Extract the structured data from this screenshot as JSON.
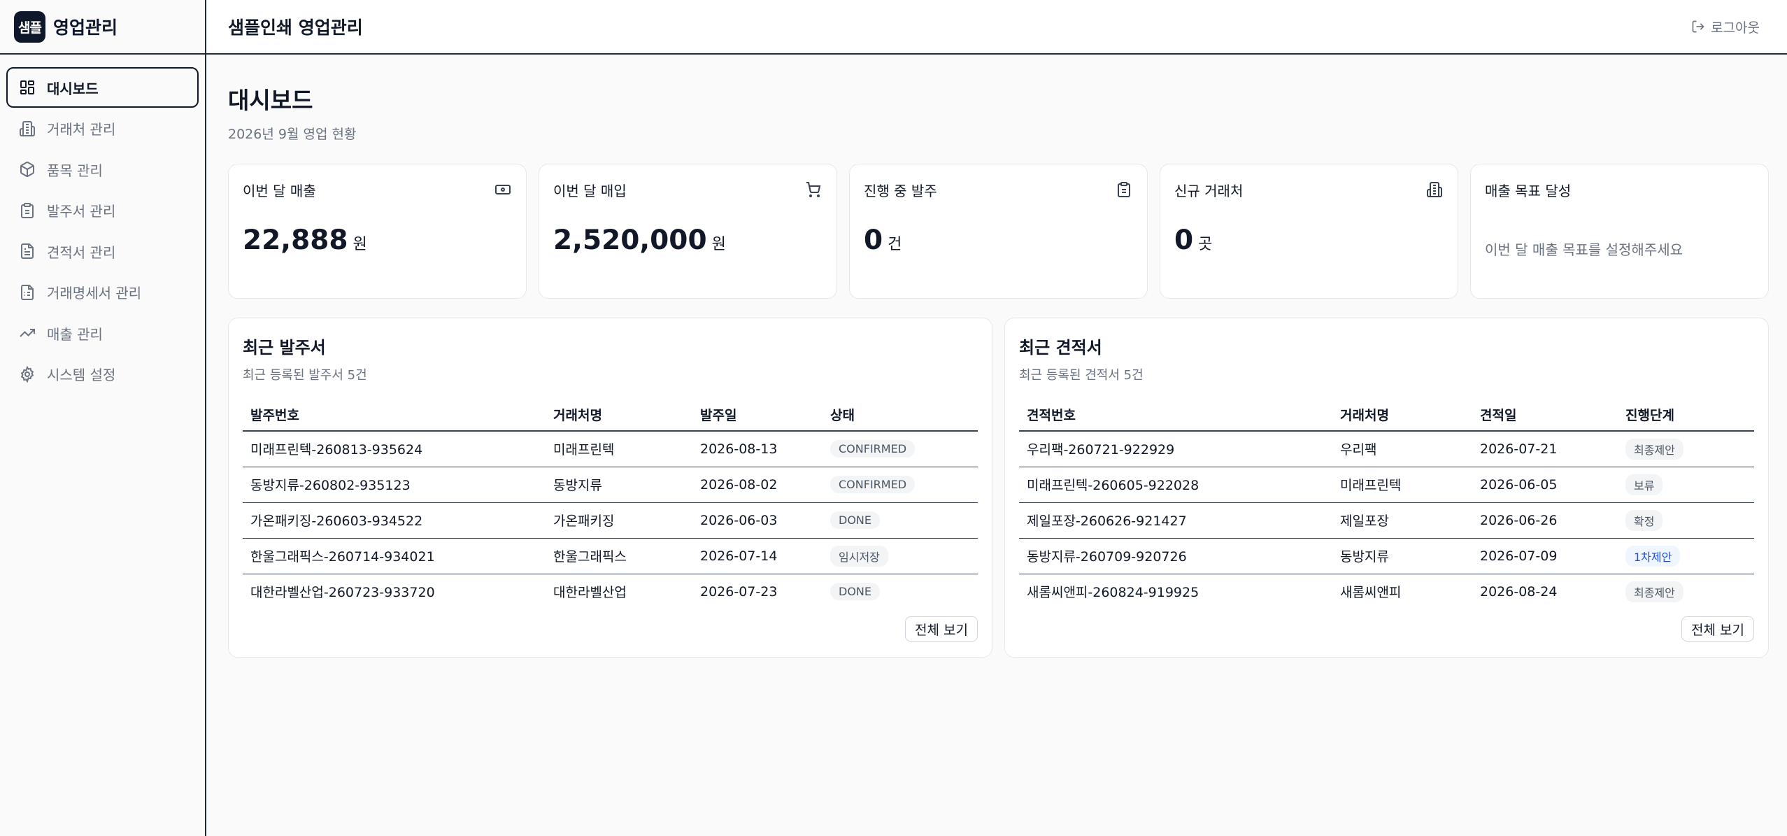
{
  "brand": {
    "logo_text": "샘플",
    "name": "영업관리"
  },
  "sidebar": {
    "items": [
      {
        "label": "대시보드",
        "icon": "dashboard-icon"
      },
      {
        "label": "거래처 관리",
        "icon": "building-icon"
      },
      {
        "label": "품목 관리",
        "icon": "box-icon"
      },
      {
        "label": "발주서 관리",
        "icon": "clipboard-icon"
      },
      {
        "label": "견적서 관리",
        "icon": "document-icon"
      },
      {
        "label": "거래명세서 관리",
        "icon": "receipt-icon"
      },
      {
        "label": "매출 관리",
        "icon": "trend-up-icon"
      },
      {
        "label": "시스템 설정",
        "icon": "gear-icon"
      }
    ]
  },
  "topbar": {
    "title": "샘플인쇄 영업관리",
    "logout": "로그아웃"
  },
  "page": {
    "title": "대시보드",
    "subtitle": "2026년 9월 영업 현황"
  },
  "stats": [
    {
      "label": "이번 달 매출",
      "value": "22,888",
      "unit": "원",
      "icon": "cash-icon"
    },
    {
      "label": "이번 달 매입",
      "value": "2,520,000",
      "unit": "원",
      "icon": "cart-icon"
    },
    {
      "label": "진행 중 발주",
      "value": "0",
      "unit": "건",
      "icon": "clipboard-icon"
    },
    {
      "label": "신규 거래처",
      "value": "0",
      "unit": "곳",
      "icon": "building-icon"
    },
    {
      "label": "매출 목표 달성",
      "note": "이번 달 매출 목표를 설정해주세요"
    }
  ],
  "orders": {
    "title": "최근 발주서",
    "subtitle": "최근 등록된 발주서 5건",
    "columns": [
      "발주번호",
      "거래처명",
      "발주일",
      "상태"
    ],
    "rows": [
      [
        "미래프린텍-260813-935624",
        "미래프린텍",
        "2026-08-13",
        "CONFIRMED"
      ],
      [
        "동방지류-260802-935123",
        "동방지류",
        "2026-08-02",
        "CONFIRMED"
      ],
      [
        "가온패키징-260603-934522",
        "가온패키징",
        "2026-06-03",
        "DONE"
      ],
      [
        "한울그래픽스-260714-934021",
        "한울그래픽스",
        "2026-07-14",
        "임시저장"
      ],
      [
        "대한라벨산업-260723-933720",
        "대한라벨산업",
        "2026-07-23",
        "DONE"
      ]
    ],
    "view_all": "전체 보기"
  },
  "quotes": {
    "title": "최근 견적서",
    "subtitle": "최근 등록된 견적서 5건",
    "columns": [
      "견적번호",
      "거래처명",
      "견적일",
      "진행단계"
    ],
    "rows": [
      [
        "우리팩-260721-922929",
        "우리팩",
        "2026-07-21",
        "최종제안"
      ],
      [
        "미래프린텍-260605-922028",
        "미래프린텍",
        "2026-06-05",
        "보류"
      ],
      [
        "제일포장-260626-921427",
        "제일포장",
        "2026-06-26",
        "확정"
      ],
      [
        "동방지류-260709-920726",
        "동방지류",
        "2026-07-09",
        "1차제안"
      ],
      [
        "새롬씨앤피-260824-919925",
        "새롬씨앤피",
        "2026-08-24",
        "최종제안"
      ]
    ],
    "view_all": "전체 보기"
  }
}
